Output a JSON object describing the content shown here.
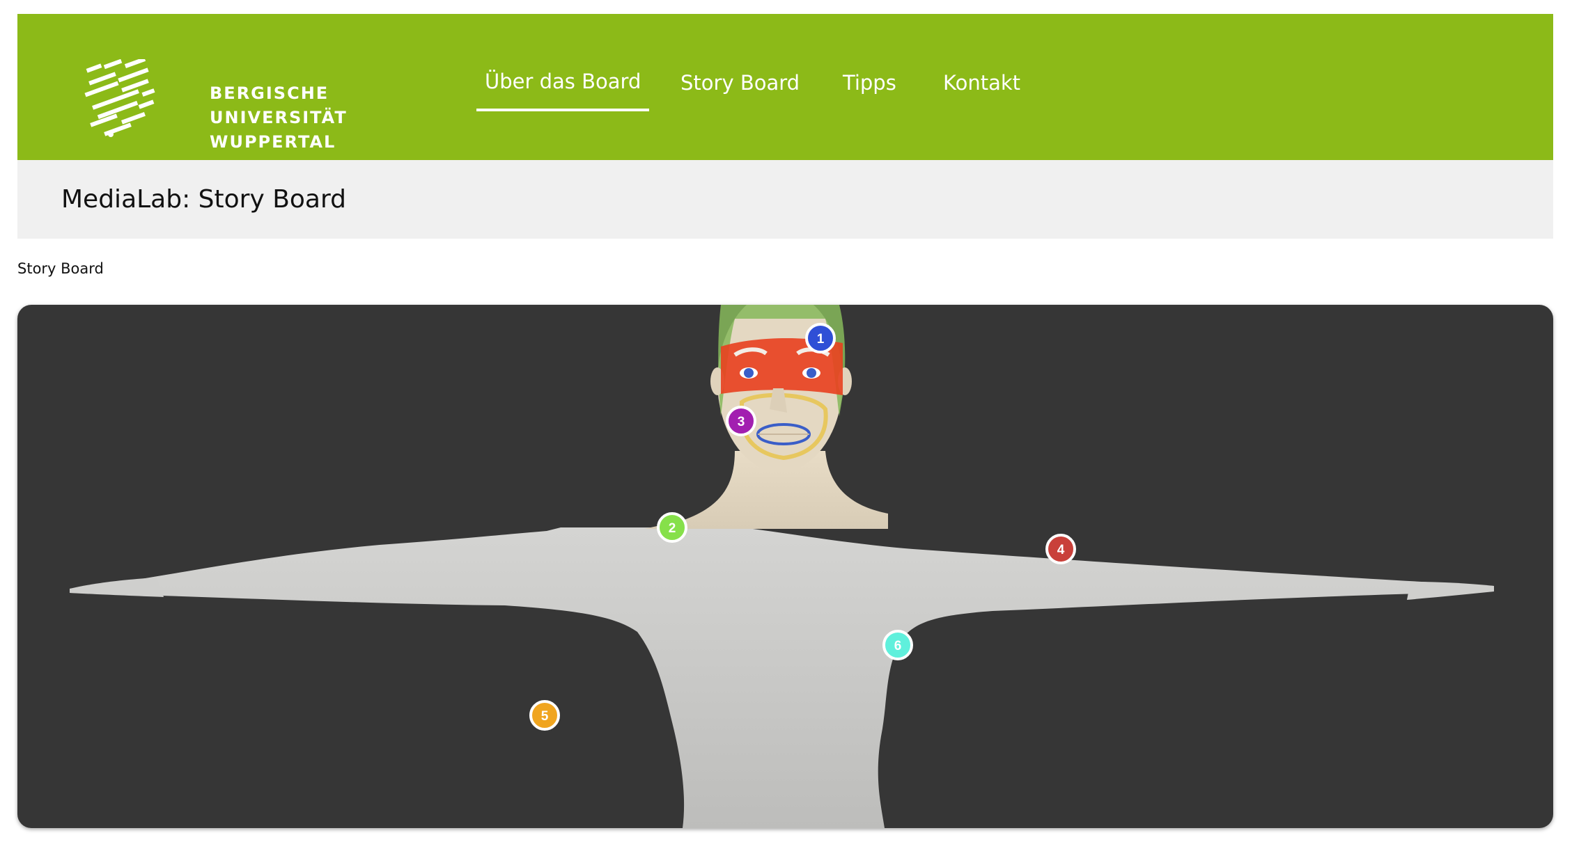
{
  "logo": {
    "line1": "BERGISCHE",
    "line2": "UNIVERSITÄT",
    "line3": "WUPPERTAL",
    "icon": "lion-crest-icon"
  },
  "nav": {
    "items": [
      {
        "label": "Über das Board",
        "active": true
      },
      {
        "label": "Story Board",
        "active": false
      },
      {
        "label": "Tipps",
        "active": false
      },
      {
        "label": "Kontakt",
        "active": false
      }
    ]
  },
  "page": {
    "title": "MediaLab: Story Board",
    "breadcrumb": "Story Board"
  },
  "viewer": {
    "markers": [
      {
        "number": "1",
        "color": "#2f4fd6"
      },
      {
        "number": "2",
        "color": "#86e04a"
      },
      {
        "number": "3",
        "color": "#a21fb0"
      },
      {
        "number": "4",
        "color": "#c9403a"
      },
      {
        "number": "5",
        "color": "#f0a51f"
      },
      {
        "number": "6",
        "color": "#5ff0dc"
      }
    ]
  },
  "colors": {
    "header": "#8cba18",
    "title_bar": "#f0f0f0",
    "viewer_bg": "#363636"
  }
}
